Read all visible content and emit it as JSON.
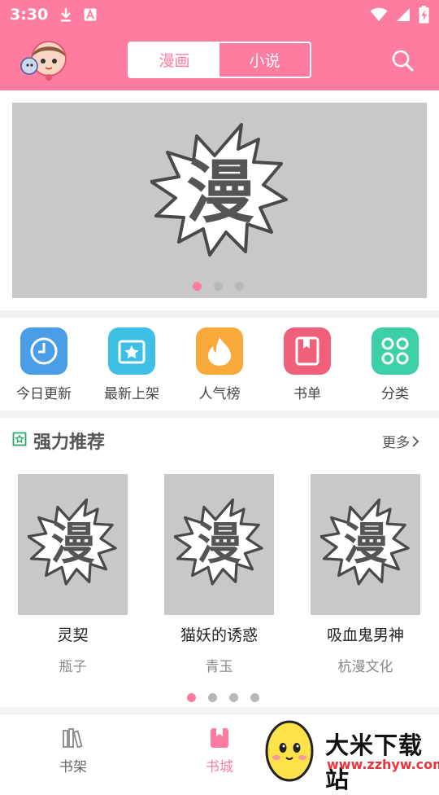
{
  "status_bar": {
    "time": "3:30"
  },
  "header": {
    "tabs": [
      {
        "label": "漫画",
        "active": true
      },
      {
        "label": "小说",
        "active": false
      }
    ]
  },
  "banner": {
    "placeholder_text": "漫",
    "page_count": 3,
    "active_page": 0
  },
  "entries": [
    {
      "label": "今日更新",
      "icon": "clock-icon",
      "color": "#4a9ee8"
    },
    {
      "label": "最新上架",
      "icon": "star-box-icon",
      "color": "#3ec0e6"
    },
    {
      "label": "人气榜",
      "icon": "flame-icon",
      "color": "#f9a93a"
    },
    {
      "label": "书单",
      "icon": "bookmark-book-icon",
      "color": "#f0607a"
    },
    {
      "label": "分类",
      "icon": "grid-icon",
      "color": "#3dd0a6"
    }
  ],
  "recommend": {
    "title": "强力推荐",
    "more": "更多",
    "books": [
      {
        "title": "灵契",
        "author": "瓶子",
        "cover_text": "漫"
      },
      {
        "title": "猫妖的诱惑",
        "author": "青玉",
        "cover_text": "漫"
      },
      {
        "title": "吸血鬼男神",
        "author": "杭漫文化",
        "cover_text": "漫"
      }
    ],
    "page_count": 4,
    "active_page": 0
  },
  "tabbar": {
    "tabs": [
      {
        "label": "书架",
        "icon": "bookshelf-icon",
        "active": false
      },
      {
        "label": "书城",
        "icon": "book-icon",
        "active": true
      }
    ]
  },
  "watermark": {
    "title": "大米下载站",
    "url": "www.zzhyw.com"
  },
  "colors": {
    "accent": "#fd7c9f",
    "placeholder_bg": "#c8c8c8"
  }
}
